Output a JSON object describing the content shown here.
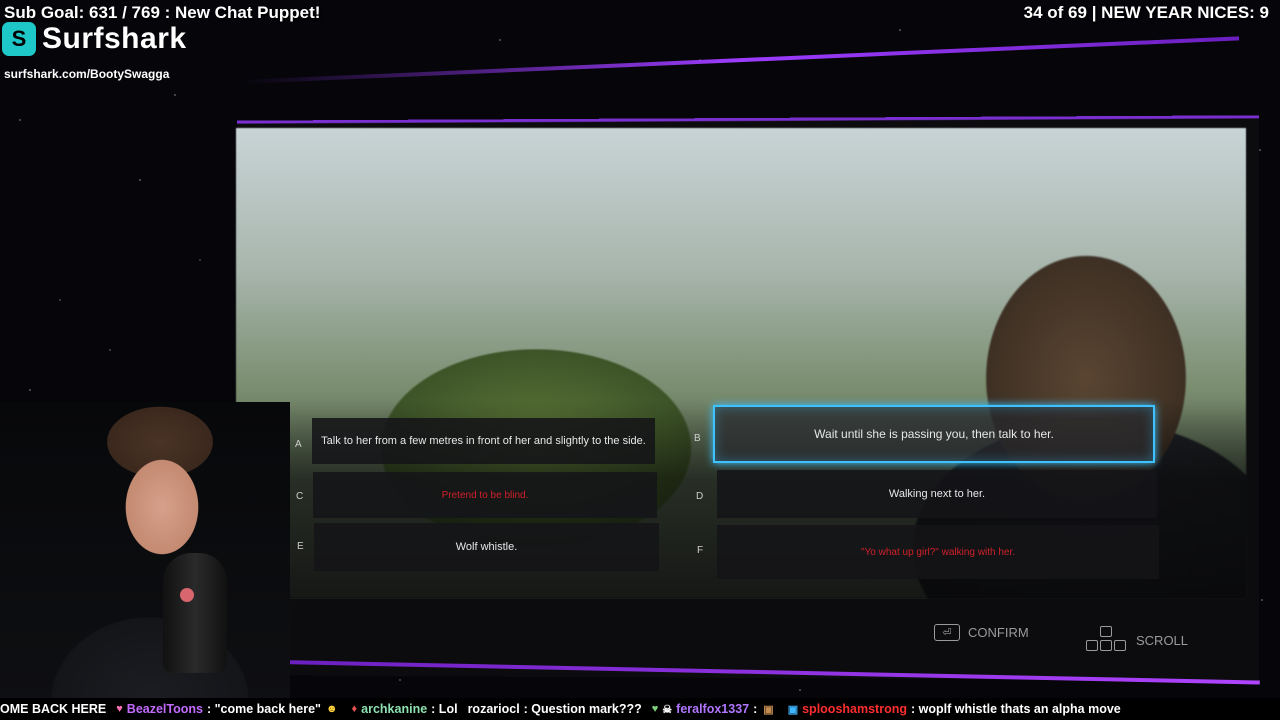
{
  "overlay": {
    "sub_goal": "Sub Goal: 631 / 769 : New Chat Puppet!",
    "nices": "34 of 69 | NEW YEAR NICES: 9",
    "sponsor_name": "Surfshark",
    "sponsor_url": "surfshark.com/BootySwagga"
  },
  "game": {
    "choices": [
      {
        "letter": "A",
        "text": "Talk to her from a few metres in front of her and slightly to the side.",
        "style": "normal"
      },
      {
        "letter": "B",
        "text": "Wait until she is passing you, then talk to her.",
        "style": "selected"
      },
      {
        "letter": "C",
        "text": "Pretend to be blind.",
        "style": "bad"
      },
      {
        "letter": "D",
        "text": "Walking next to her.",
        "style": "normal"
      },
      {
        "letter": "E",
        "text": "Wolf whistle.",
        "style": "normal"
      },
      {
        "letter": "F",
        "text": "\"Yo what up girl?\" walking with her.",
        "style": "bad"
      }
    ],
    "controls": {
      "confirm_label": "CONFIRM",
      "scroll_label": "SCROLL"
    }
  },
  "ticker": [
    {
      "user": "",
      "message": "OME BACK HERE"
    },
    {
      "user": "BeazelToons",
      "message": ": \"come back here\""
    },
    {
      "user": "archkanine",
      "message": ": Lol"
    },
    {
      "user": "rozariocl",
      "message": ": Question mark???"
    },
    {
      "user": "feralfox1337",
      "message": ":"
    },
    {
      "user": "splooshamstrong",
      "message": ": woplf whistle  thats an alpha move"
    }
  ],
  "colors": {
    "selection_glow": "#3ec2ff",
    "bad_option": "#d0202a",
    "stream_accent": "#9d3cff"
  }
}
